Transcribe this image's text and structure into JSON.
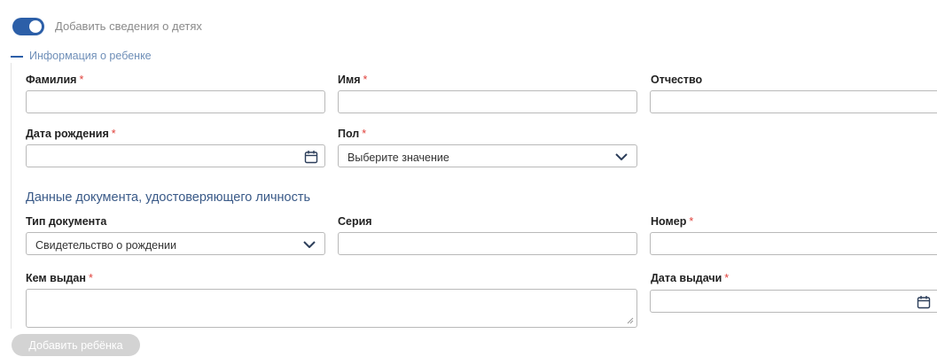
{
  "toggle": {
    "label": "Добавить сведения о детях",
    "on": true
  },
  "section": {
    "title": "Информация о ребенке"
  },
  "fields": {
    "last_name": {
      "label": "Фамилия",
      "required": "*",
      "value": ""
    },
    "first_name": {
      "label": "Имя",
      "required": "*",
      "value": ""
    },
    "patronymic": {
      "label": "Отчество",
      "value": ""
    },
    "birth_date": {
      "label": "Дата рождения",
      "required": "*",
      "value": ""
    },
    "gender": {
      "label": "Пол",
      "required": "*",
      "value": "Выберите значение"
    }
  },
  "document": {
    "title": "Данные документа, удостоверяющего личность",
    "type": {
      "label": "Тип документа",
      "value": "Свидетельство о рождении"
    },
    "series": {
      "label": "Серия",
      "value": ""
    },
    "number": {
      "label": "Номер",
      "required": "*",
      "value": ""
    },
    "issued_by": {
      "label": "Кем выдан",
      "required": "*",
      "value": ""
    },
    "issue_date": {
      "label": "Дата выдачи",
      "required": "*",
      "value": ""
    }
  },
  "actions": {
    "add_child": "Добавить ребёнка"
  },
  "colors": {
    "accent": "#2c5fa8",
    "required": "#e0403a",
    "disabled_button": "#d3d3d3"
  },
  "icons": {
    "calendar": "calendar-icon",
    "chevron": "chevron-down-icon"
  }
}
